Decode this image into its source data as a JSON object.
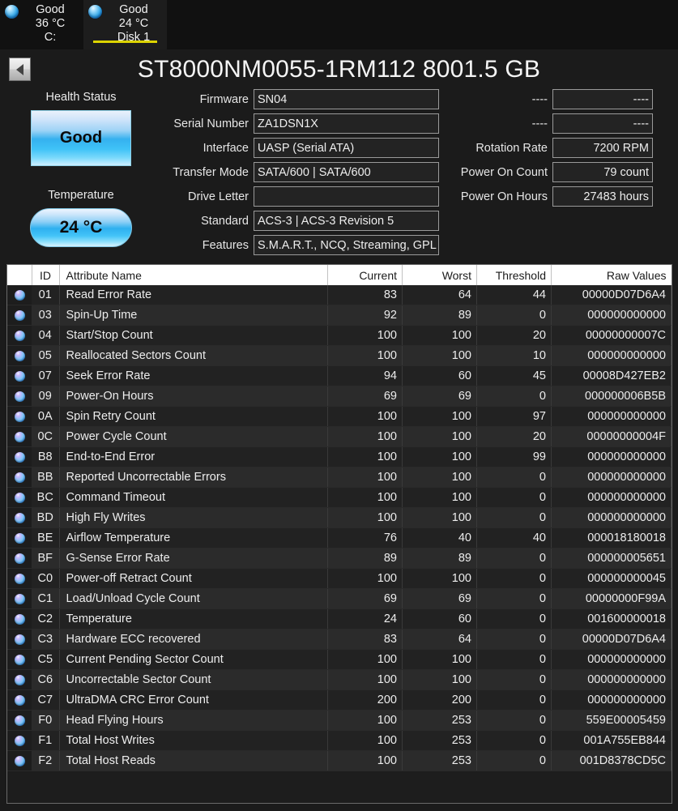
{
  "tabs": [
    {
      "status": "Good",
      "temp": "36 °C",
      "name": "C:",
      "active": false,
      "icon": "status-orb-icon"
    },
    {
      "status": "Good",
      "temp": "24 °C",
      "name": "Disk 1",
      "active": true,
      "icon": "status-orb-icon"
    }
  ],
  "header": {
    "back_icon": "back-arrow-icon",
    "title": "ST8000NM0055-1RM112 8001.5 GB"
  },
  "left_panel": {
    "health_label": "Health Status",
    "health_value": "Good",
    "temperature_label": "Temperature",
    "temperature_value": "24 °C"
  },
  "fields_left": [
    {
      "label": "Firmware",
      "value": "SN04"
    },
    {
      "label": "Serial Number",
      "value": "ZA1DSN1X"
    },
    {
      "label": "Interface",
      "value": "UASP (Serial ATA)"
    },
    {
      "label": "Transfer Mode",
      "value": "SATA/600 | SATA/600"
    },
    {
      "label": "Drive Letter",
      "value": ""
    }
  ],
  "fields_right": [
    {
      "label": "----",
      "value": "----"
    },
    {
      "label": "----",
      "value": "----"
    },
    {
      "label": "Rotation Rate",
      "value": "7200 RPM"
    },
    {
      "label": "Power On Count",
      "value": "79 count"
    },
    {
      "label": "Power On Hours",
      "value": "27483 hours"
    }
  ],
  "fields_wide": [
    {
      "label": "Standard",
      "value": "ACS-3 | ACS-3 Revision 5"
    },
    {
      "label": "Features",
      "value": "S.M.A.R.T., NCQ, Streaming, GPL"
    }
  ],
  "table": {
    "columns": [
      "",
      "ID",
      "Attribute Name",
      "Current",
      "Worst",
      "Threshold",
      "Raw Values"
    ],
    "rows": [
      {
        "id": "01",
        "name": "Read Error Rate",
        "current": "83",
        "worst": "64",
        "threshold": "44",
        "raw": "00000D07D6A4"
      },
      {
        "id": "03",
        "name": "Spin-Up Time",
        "current": "92",
        "worst": "89",
        "threshold": "0",
        "raw": "000000000000"
      },
      {
        "id": "04",
        "name": "Start/Stop Count",
        "current": "100",
        "worst": "100",
        "threshold": "20",
        "raw": "00000000007C"
      },
      {
        "id": "05",
        "name": "Reallocated Sectors Count",
        "current": "100",
        "worst": "100",
        "threshold": "10",
        "raw": "000000000000"
      },
      {
        "id": "07",
        "name": "Seek Error Rate",
        "current": "94",
        "worst": "60",
        "threshold": "45",
        "raw": "00008D427EB2"
      },
      {
        "id": "09",
        "name": "Power-On Hours",
        "current": "69",
        "worst": "69",
        "threshold": "0",
        "raw": "000000006B5B"
      },
      {
        "id": "0A",
        "name": "Spin Retry Count",
        "current": "100",
        "worst": "100",
        "threshold": "97",
        "raw": "000000000000"
      },
      {
        "id": "0C",
        "name": "Power Cycle Count",
        "current": "100",
        "worst": "100",
        "threshold": "20",
        "raw": "00000000004F"
      },
      {
        "id": "B8",
        "name": "End-to-End Error",
        "current": "100",
        "worst": "100",
        "threshold": "99",
        "raw": "000000000000"
      },
      {
        "id": "BB",
        "name": "Reported Uncorrectable Errors",
        "current": "100",
        "worst": "100",
        "threshold": "0",
        "raw": "000000000000"
      },
      {
        "id": "BC",
        "name": "Command Timeout",
        "current": "100",
        "worst": "100",
        "threshold": "0",
        "raw": "000000000000"
      },
      {
        "id": "BD",
        "name": "High Fly Writes",
        "current": "100",
        "worst": "100",
        "threshold": "0",
        "raw": "000000000000"
      },
      {
        "id": "BE",
        "name": "Airflow Temperature",
        "current": "76",
        "worst": "40",
        "threshold": "40",
        "raw": "000018180018"
      },
      {
        "id": "BF",
        "name": "G-Sense Error Rate",
        "current": "89",
        "worst": "89",
        "threshold": "0",
        "raw": "000000005651"
      },
      {
        "id": "C0",
        "name": "Power-off Retract Count",
        "current": "100",
        "worst": "100",
        "threshold": "0",
        "raw": "000000000045"
      },
      {
        "id": "C1",
        "name": "Load/Unload Cycle Count",
        "current": "69",
        "worst": "69",
        "threshold": "0",
        "raw": "00000000F99A"
      },
      {
        "id": "C2",
        "name": "Temperature",
        "current": "24",
        "worst": "60",
        "threshold": "0",
        "raw": "001600000018"
      },
      {
        "id": "C3",
        "name": "Hardware ECC recovered",
        "current": "83",
        "worst": "64",
        "threshold": "0",
        "raw": "00000D07D6A4"
      },
      {
        "id": "C5",
        "name": "Current Pending Sector Count",
        "current": "100",
        "worst": "100",
        "threshold": "0",
        "raw": "000000000000"
      },
      {
        "id": "C6",
        "name": "Uncorrectable Sector Count",
        "current": "100",
        "worst": "100",
        "threshold": "0",
        "raw": "000000000000"
      },
      {
        "id": "C7",
        "name": "UltraDMA CRC Error Count",
        "current": "200",
        "worst": "200",
        "threshold": "0",
        "raw": "000000000000"
      },
      {
        "id": "F0",
        "name": "Head Flying Hours",
        "current": "100",
        "worst": "253",
        "threshold": "0",
        "raw": "559E00005459"
      },
      {
        "id": "F1",
        "name": "Total Host Writes",
        "current": "100",
        "worst": "253",
        "threshold": "0",
        "raw": "001A755EB844"
      },
      {
        "id": "F2",
        "name": "Total Host Reads",
        "current": "100",
        "worst": "253",
        "threshold": "0",
        "raw": "001D8378CD5C"
      }
    ]
  },
  "colors": {
    "accent_tab": "#ddd400",
    "status_good": "#35b1ef",
    "background": "#1b1b1b",
    "header_row": "#ffffff"
  }
}
